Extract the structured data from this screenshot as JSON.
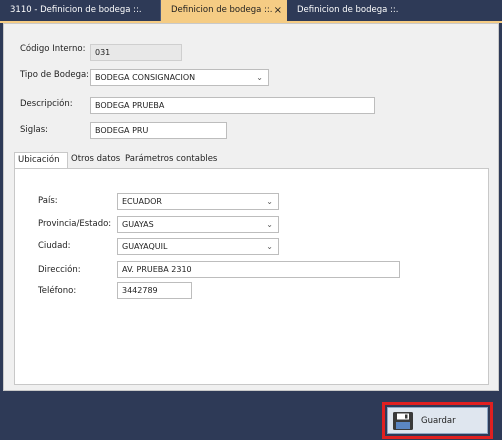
{
  "tabs": [
    {
      "label": "3110 - Definicion de bodega ::."
    },
    {
      "label": "Definicion de bodega ::.",
      "close": "×"
    },
    {
      "label": "Definicion de bodega ::."
    }
  ],
  "form": {
    "codigo_label": "Código Interno:",
    "codigo_value": "031",
    "tipo_label": "Tipo de Bodega:",
    "tipo_value": "BODEGA CONSIGNACION",
    "descripcion_label": "Descripción:",
    "descripcion_value": "BODEGA PRUEBA",
    "siglas_label": "Siglas:",
    "siglas_value": "BODEGA PRU"
  },
  "inner_tabs": [
    {
      "label": "Ubicación"
    },
    {
      "label": "Otros datos"
    },
    {
      "label": "Parámetros contables"
    }
  ],
  "ubicacion": {
    "pais_label": "País:",
    "pais_value": "ECUADOR",
    "provincia_label": "Provincia/Estado:",
    "provincia_value": "GUAYAS",
    "ciudad_label": "Ciudad:",
    "ciudad_value": "GUAYAQUIL",
    "direccion_label": "Dirección:",
    "direccion_value": "AV. PRUEBA 2310",
    "telefono_label": "Teléfono:",
    "telefono_value": "3442789"
  },
  "toolbar": {
    "save_label": "Guardar"
  },
  "colors": {
    "active_tab": "#f5cc84",
    "frame": "#2e3a57",
    "highlight": "#e02020"
  }
}
